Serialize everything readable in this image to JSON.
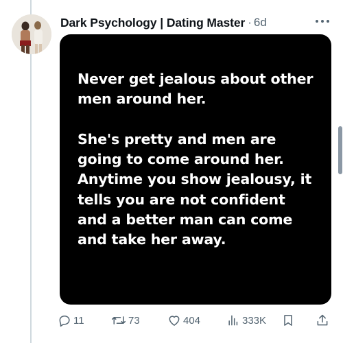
{
  "post": {
    "author_name": "Dark Psychology | Dating Master",
    "separator": "·",
    "time": "6d",
    "media_lines_block1": [
      "Never get jealous about other",
      "men around her."
    ],
    "media_lines_block2": [
      "She's pretty and men are",
      "going to come around her.",
      "Anytime you show jealousy, it",
      "tells you are not confident",
      "and a better man can come",
      "and take her away."
    ]
  },
  "actions": {
    "reply_count": "11",
    "repost_count": "73",
    "like_count": "404",
    "views_count": "333K"
  },
  "icons": {
    "more": "more-icon",
    "reply": "reply-icon",
    "repost": "repost-icon",
    "like": "heart-icon",
    "views": "views-icon",
    "bookmark": "bookmark-icon",
    "share": "share-icon"
  },
  "colors": {
    "text": "#0f1419",
    "secondary": "#536471",
    "media_bg": "#000000",
    "thread_line": "#cfd9de"
  }
}
